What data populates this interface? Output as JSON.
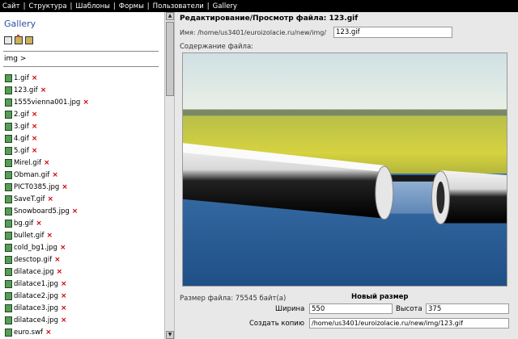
{
  "topnav": {
    "items": [
      "Сайт",
      "Структура",
      "Шаблоны",
      "Формы",
      "Пользователи",
      "Gallery"
    ]
  },
  "sidebar": {
    "title": "Gallery",
    "path": "img >",
    "files": [
      "1.gif",
      "123.gif",
      "1555vienna001.jpg",
      "2.gif",
      "3.gif",
      "4.gif",
      "5.gif",
      "Mirel.gif",
      "Obman.gif",
      "PICT0385.jpg",
      "SaveT.gif",
      "Snowboard5.jpg",
      "bg.gif",
      "bullet.gif",
      "cold_bg1.jpg",
      "desctop.gif",
      "dilatace.jpg",
      "dilatace1.jpg",
      "dilatace2.jpg",
      "dilatace3.jpg",
      "dilatace4.jpg",
      "euro.swf"
    ],
    "delete_glyph": "×"
  },
  "editor": {
    "header": "Редактирование/Просмотр файла: 123.gif",
    "name_label": "Имя: /home/us3401/euroizolacie.ru/new/img/",
    "name_value": "123.gif",
    "content_label": "Содержание файла:",
    "size_text": "Размер файла: 75545 байт(а)",
    "new_size_title": "Новый размер",
    "width_label": "Ширина",
    "width_value": "550",
    "height_label": "Высота",
    "height_value": "375",
    "copy_label": "Создать копию",
    "copy_value": "/home/us3401/euroizolacie.ru/new/img/123.gif"
  },
  "colors": {
    "topnav_bg": "#000000",
    "gallery_title": "#2a4fa0",
    "delete_mark": "#cc0000",
    "editor_bg": "#e8e8e8"
  }
}
